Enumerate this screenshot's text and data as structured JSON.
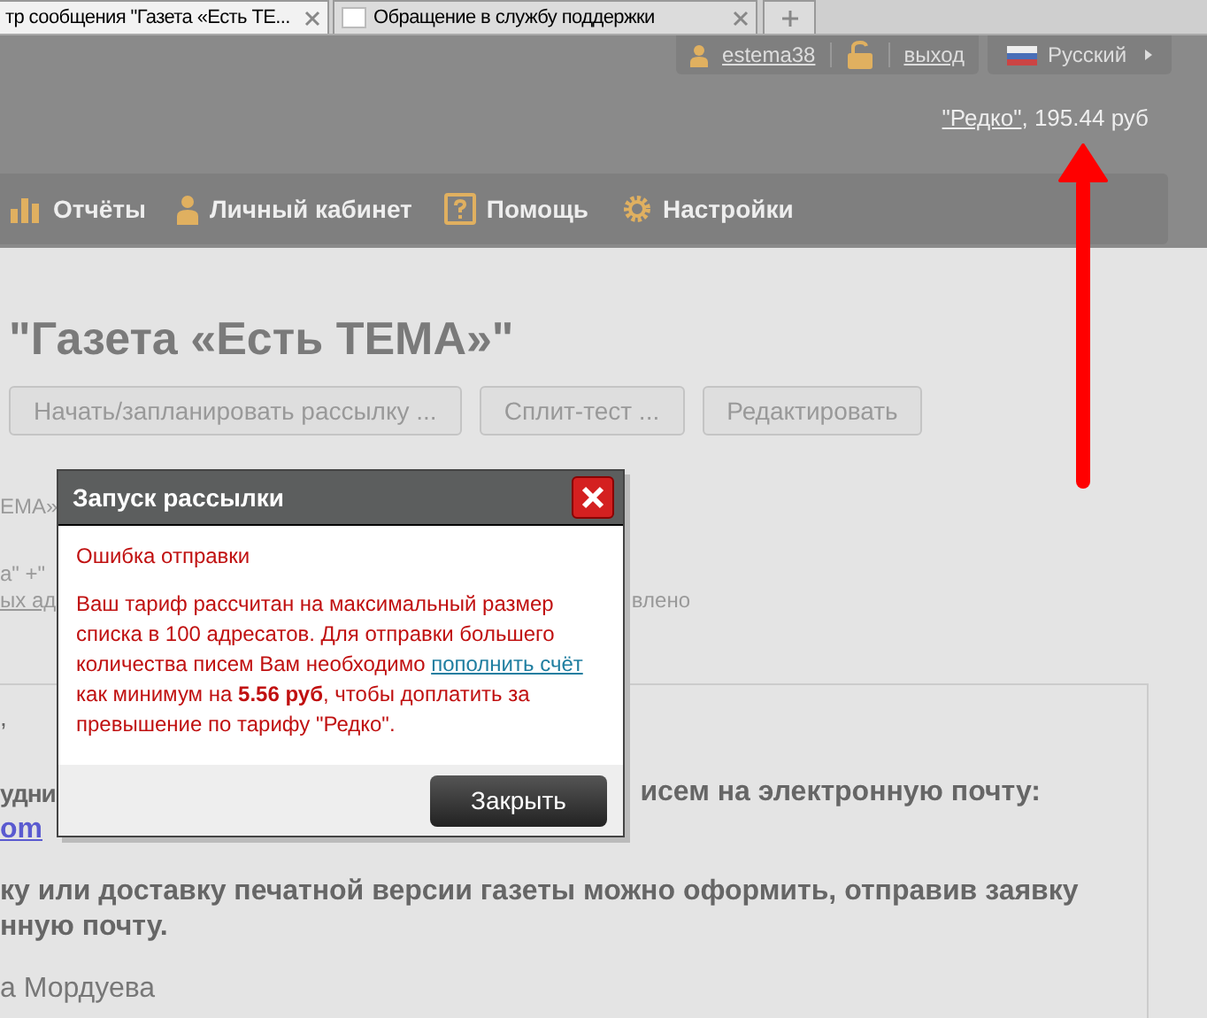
{
  "browser_tabs": [
    {
      "title": "тр сообщения \"Газета «Есть TE...",
      "selected": true
    },
    {
      "title": "Обращение в службу поддержки",
      "selected": false
    }
  ],
  "header": {
    "username": "estema38",
    "logout": "выход",
    "language": "Русский",
    "tariff": "\"Редко\"",
    "balance": ", 195.44 руб"
  },
  "nav": [
    {
      "kind": "chart",
      "label": "Отчёты"
    },
    {
      "kind": "person",
      "label": "Личный кабинет"
    },
    {
      "kind": "help",
      "label": "Помощь"
    },
    {
      "kind": "gear",
      "label": "Настройки"
    }
  ],
  "page": {
    "title": "\"Газета «Есть TEMA»\"",
    "buttons": [
      "Начать/запланировать рассылку ...",
      "Сплит-тест ...",
      "Редактировать"
    ],
    "fragment_1": "EMA»",
    "fragment_2": "a\" +\"",
    "fragment_3": "ых ад",
    "fragment_4": "влено",
    "box_fragment_1": ",",
    "box_fragment_2": "удни",
    "box_fragment_3": "исем на электронную почту:",
    "box_link_fragment": "om",
    "box_line_1": "ку или доставку печатной версии газеты можно оформить, отправив заявку",
    "box_line_2": "нную почту.",
    "signature": "а Мордуева"
  },
  "dialog": {
    "title": "Запуск рассылки",
    "error": "Ошибка отправки",
    "message_before": "Ваш тариф рассчитан на максимальный размер списка в 100 адресатов. Для отправки большего количества писем Вам необходимо",
    "message_link": "пополнить счёт",
    "message_after": "как минимум на **5.56 руб**, чтобы доплатить за превышение по тарифу \"Редко\".",
    "close_button": "Закрыть"
  }
}
